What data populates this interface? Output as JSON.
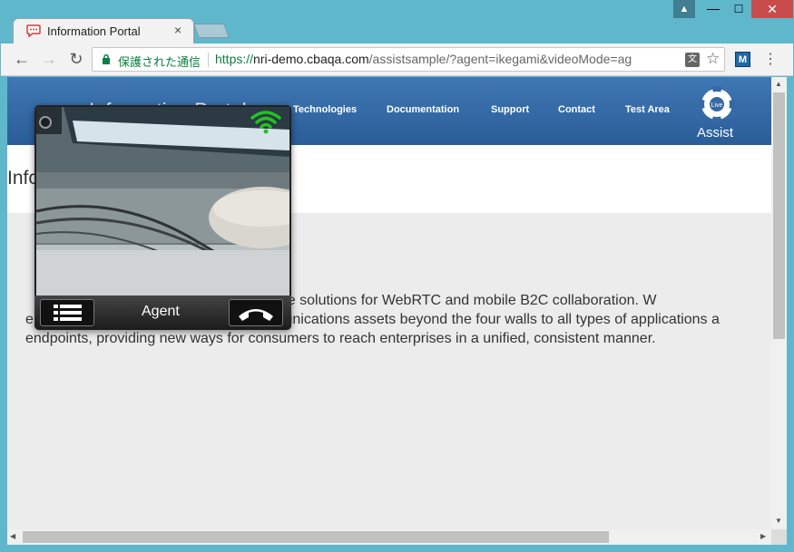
{
  "browser": {
    "tab_title": "Information Portal",
    "tab_close": "×",
    "secure_label": "保護された通信",
    "url_scheme": "https://",
    "url_host": "nri-demo.cbaqa.com",
    "url_path": "/assistsample/?agent=ikegami&videoMode=ag",
    "back_glyph": "←",
    "forward_glyph": "→",
    "reload_glyph": "↻",
    "translate_glyph": "文",
    "star_glyph": "☆",
    "extension_label": "M",
    "menu_glyph": "⋮",
    "window_min": "—",
    "window_max": "☐",
    "window_close": "✕",
    "user_glyph": "▲"
  },
  "site": {
    "logo_text": "Information Portal",
    "nav": [
      "Technologies",
      "Documentation",
      "Support",
      "Contact",
      "Test Area"
    ],
    "assist_label": "Assist",
    "assist_icon_text": "Live",
    "heading": "Information Portal",
    "body_lines": [
      "CafeX provides a suite of software solutions for WebRTC and mobile B2C collaboration. W",
      "enable enterprises to extend their communications assets beyond the four walls to all types of applications a",
      "endpoints, providing new ways for consumers to reach enterprises in a unified, consistent manner."
    ]
  },
  "agent_widget": {
    "label": "Agent",
    "icons": {
      "signal": "wifi-icon",
      "list": "list-icon",
      "hangup": "hangup-icon"
    },
    "signal_color": "#22c322"
  },
  "colors": {
    "header_blue": "#2f6aa8",
    "close_red": "#c94c4c",
    "secure_green": "#0b8043"
  }
}
